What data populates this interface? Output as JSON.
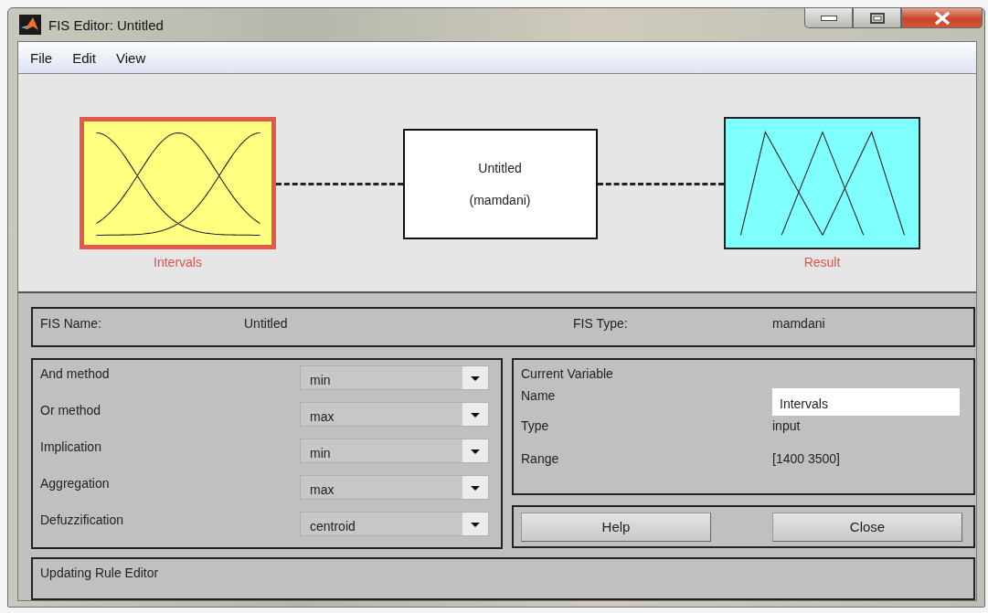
{
  "window": {
    "title": "FIS Editor: Untitled"
  },
  "menu": [
    "File",
    "Edit",
    "View"
  ],
  "diagram": {
    "inputs": [
      {
        "label": "Intervals",
        "selected": true,
        "kind": "gaussian"
      }
    ],
    "system": {
      "name": "Untitled",
      "type": "(mamdani)"
    },
    "outputs": [
      {
        "label": "Result",
        "selected": false,
        "kind": "triangular"
      }
    ]
  },
  "fis": {
    "name_label": "FIS Name:",
    "name": "Untitled",
    "type_label": "FIS Type:",
    "type": "mamdani"
  },
  "methods": [
    {
      "label": "And method",
      "value": "min"
    },
    {
      "label": "Or method",
      "value": "max"
    },
    {
      "label": "Implication",
      "value": "min"
    },
    {
      "label": "Aggregation",
      "value": "max"
    },
    {
      "label": "Defuzzification",
      "value": "centroid"
    }
  ],
  "current_variable": {
    "title": "Current Variable",
    "name_label": "Name",
    "name": "Intervals",
    "type_label": "Type",
    "type": "input",
    "range_label": "Range",
    "range": "[1400 3500]"
  },
  "buttons": [
    "Help",
    "Close"
  ],
  "status": "Updating Rule Editor"
}
